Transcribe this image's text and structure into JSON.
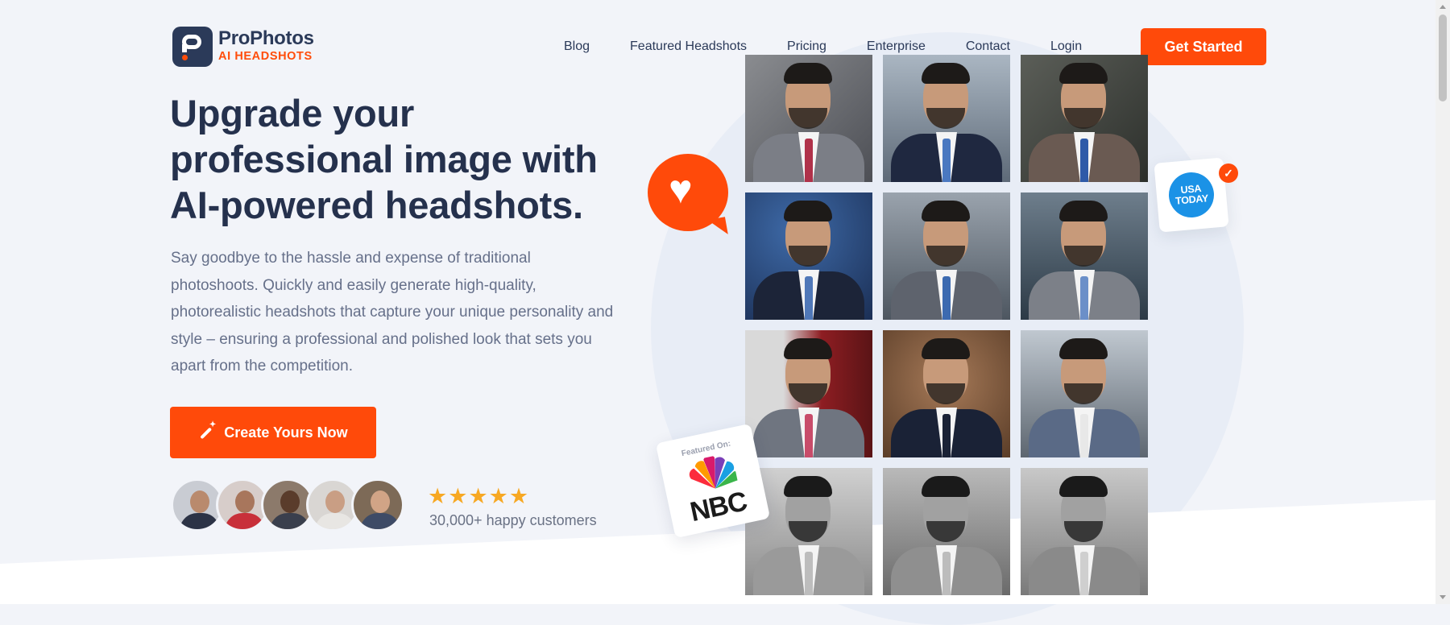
{
  "brand": {
    "name": "ProPhotos",
    "tagline": "AI HEADSHOTS",
    "accent": "#ff4a0a",
    "navy": "#25314d"
  },
  "nav": {
    "items": [
      "Blog",
      "Featured Headshots",
      "Pricing",
      "Enterprise",
      "Contact",
      "Login"
    ],
    "cta": "Get Started"
  },
  "hero": {
    "title_lines": [
      "Upgrade your",
      "professional image with",
      "AI-powered headshots."
    ],
    "description": "Say goodbye to the hassle and expense of traditional photoshoots. Quickly and easily generate high-quality, photorealistic headshots that capture your unique personality and style – ensuring a professional and polished look that sets you apart from the competition.",
    "cta": "Create Yours Now",
    "rating_stars": 5,
    "customers": "30,000+ happy customers"
  },
  "press": {
    "usa_today": [
      "USA",
      "TODAY"
    ],
    "featured_label": "Featured On:",
    "nbc": "NBC"
  },
  "icons": {
    "cta": "magic-wand-icon",
    "bubble": "heart-icon",
    "badge": "check-icon",
    "star": "star-icon"
  }
}
